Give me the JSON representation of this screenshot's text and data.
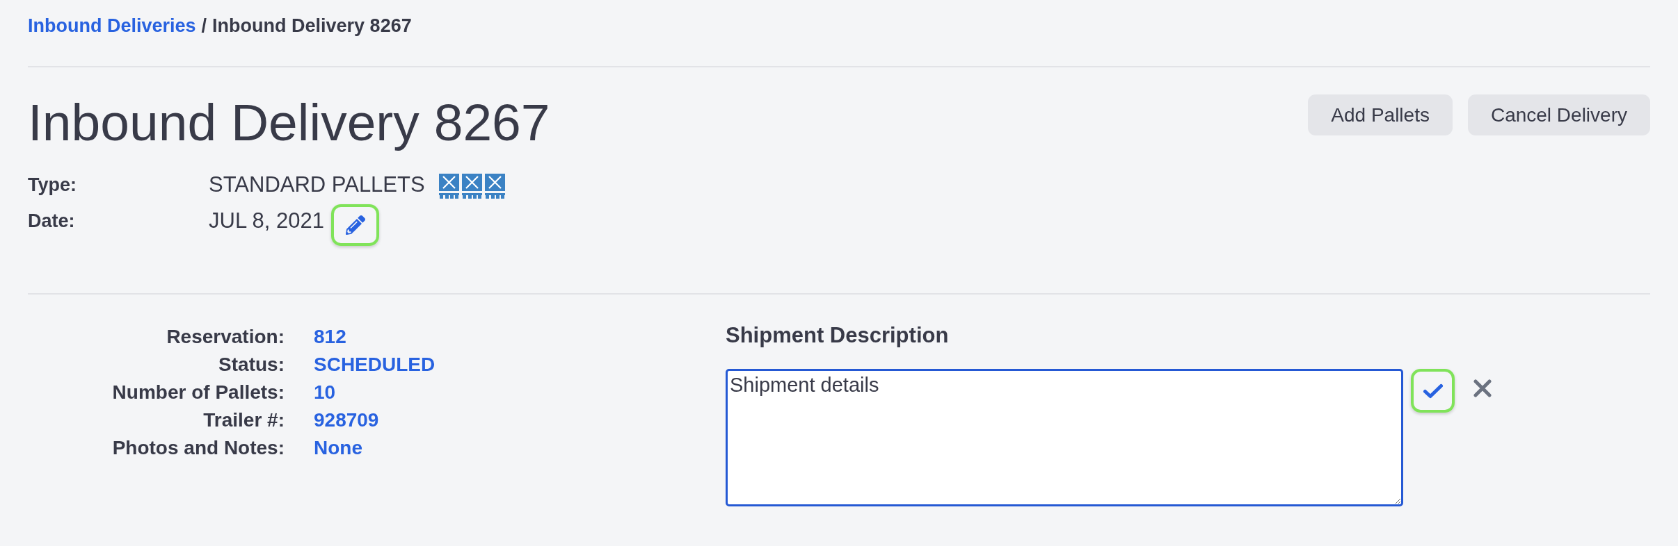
{
  "breadcrumb": {
    "items": [
      {
        "label": "Inbound Deliveries",
        "link": true
      },
      {
        "label": "Inbound Delivery 8267",
        "link": false
      }
    ],
    "separator": "/"
  },
  "header": {
    "title": "Inbound Delivery 8267",
    "actions": [
      "Add Pallets",
      "Cancel Delivery"
    ]
  },
  "summary": [
    {
      "kind": "type",
      "label": "Type:",
      "value": "STANDARD PALLETS"
    },
    {
      "kind": "date",
      "label": "Date:",
      "value": "JUL 8, 2021",
      "edit_button": {
        "highlighted": true
      }
    }
  ],
  "details": [
    {
      "label": "Reservation:",
      "value": "812"
    },
    {
      "label": "Status:",
      "value": "SCHEDULED"
    },
    {
      "label": "Number of Pallets:",
      "value": "10"
    },
    {
      "label": "Trailer #:",
      "value": "928709"
    },
    {
      "label": "Photos and Notes:",
      "value": "None"
    }
  ],
  "shipment_description": {
    "heading": "Shipment Description",
    "value": "Shipment details",
    "focused": true,
    "save_button": {
      "highlighted": true
    }
  }
}
